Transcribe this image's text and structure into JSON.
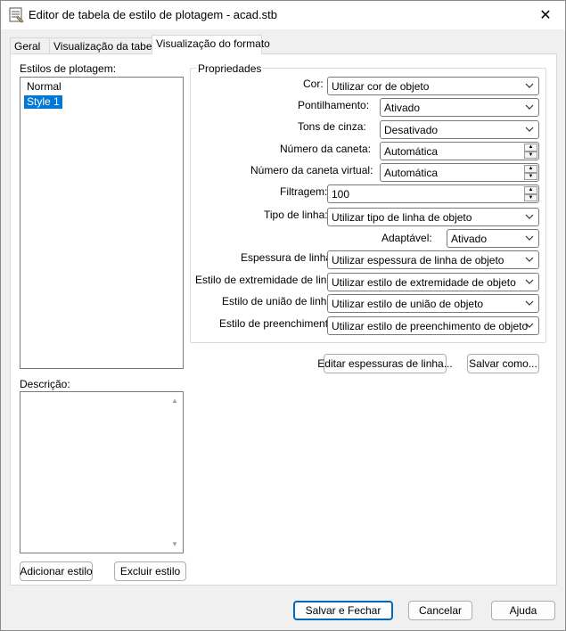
{
  "window": {
    "title": "Editor de tabela de estilo de plotagem - acad.stb",
    "close_glyph": "✕"
  },
  "tabs": [
    {
      "label": "Geral",
      "active": false
    },
    {
      "label": "Visualização da tabela",
      "active": false
    },
    {
      "label": "Visualização do formato",
      "active": true
    }
  ],
  "styles_panel": {
    "label": "Estilos de plotagem:",
    "items": [
      {
        "label": "Normal",
        "selected": false
      },
      {
        "label": "Style 1",
        "selected": true
      }
    ]
  },
  "description": {
    "label": "Descrição:",
    "value": ""
  },
  "style_buttons": {
    "add": "Adicionar estilo",
    "delete": "Excluir estilo"
  },
  "properties": {
    "group_label": "Propriedades",
    "color": {
      "label": "Cor:",
      "value": "Utilizar cor de objeto"
    },
    "dither": {
      "label": "Pontilhamento:",
      "value": "Ativado"
    },
    "grayscale": {
      "label": "Tons de cinza:",
      "value": "Desativado"
    },
    "pen_number": {
      "label": "Número da caneta:",
      "value": "Automática"
    },
    "virtual_pen": {
      "label": "Número da caneta virtual:",
      "value": "Automática"
    },
    "screening": {
      "label": "Filtragem:",
      "value": "100"
    },
    "linetype": {
      "label": "Tipo de linha:",
      "value": "Utilizar tipo de linha de objeto"
    },
    "adaptive": {
      "label": "Adaptável:",
      "value": "Ativado"
    },
    "lineweight": {
      "label": "Espessura de linha:",
      "value": "Utilizar espessura de linha de objeto"
    },
    "line_end": {
      "label": "Estilo de extremidade de linha:",
      "value": "Utilizar estilo de extremidade de objeto"
    },
    "line_join": {
      "label": "Estilo de união de linha:",
      "value": "Utilizar estilo de união de objeto"
    },
    "fill": {
      "label": "Estilo de preenchimento:",
      "value": "Utilizar estilo de preenchimento de objeto"
    }
  },
  "panel_buttons": {
    "edit_lineweights": "Editar espessuras de linha...",
    "save_as": "Salvar como..."
  },
  "footer": {
    "save_close": "Salvar e Fechar",
    "cancel": "Cancelar",
    "help": "Ajuda"
  },
  "colors": {
    "selection": "#0078d7",
    "default_button_border": "#0067c0"
  }
}
